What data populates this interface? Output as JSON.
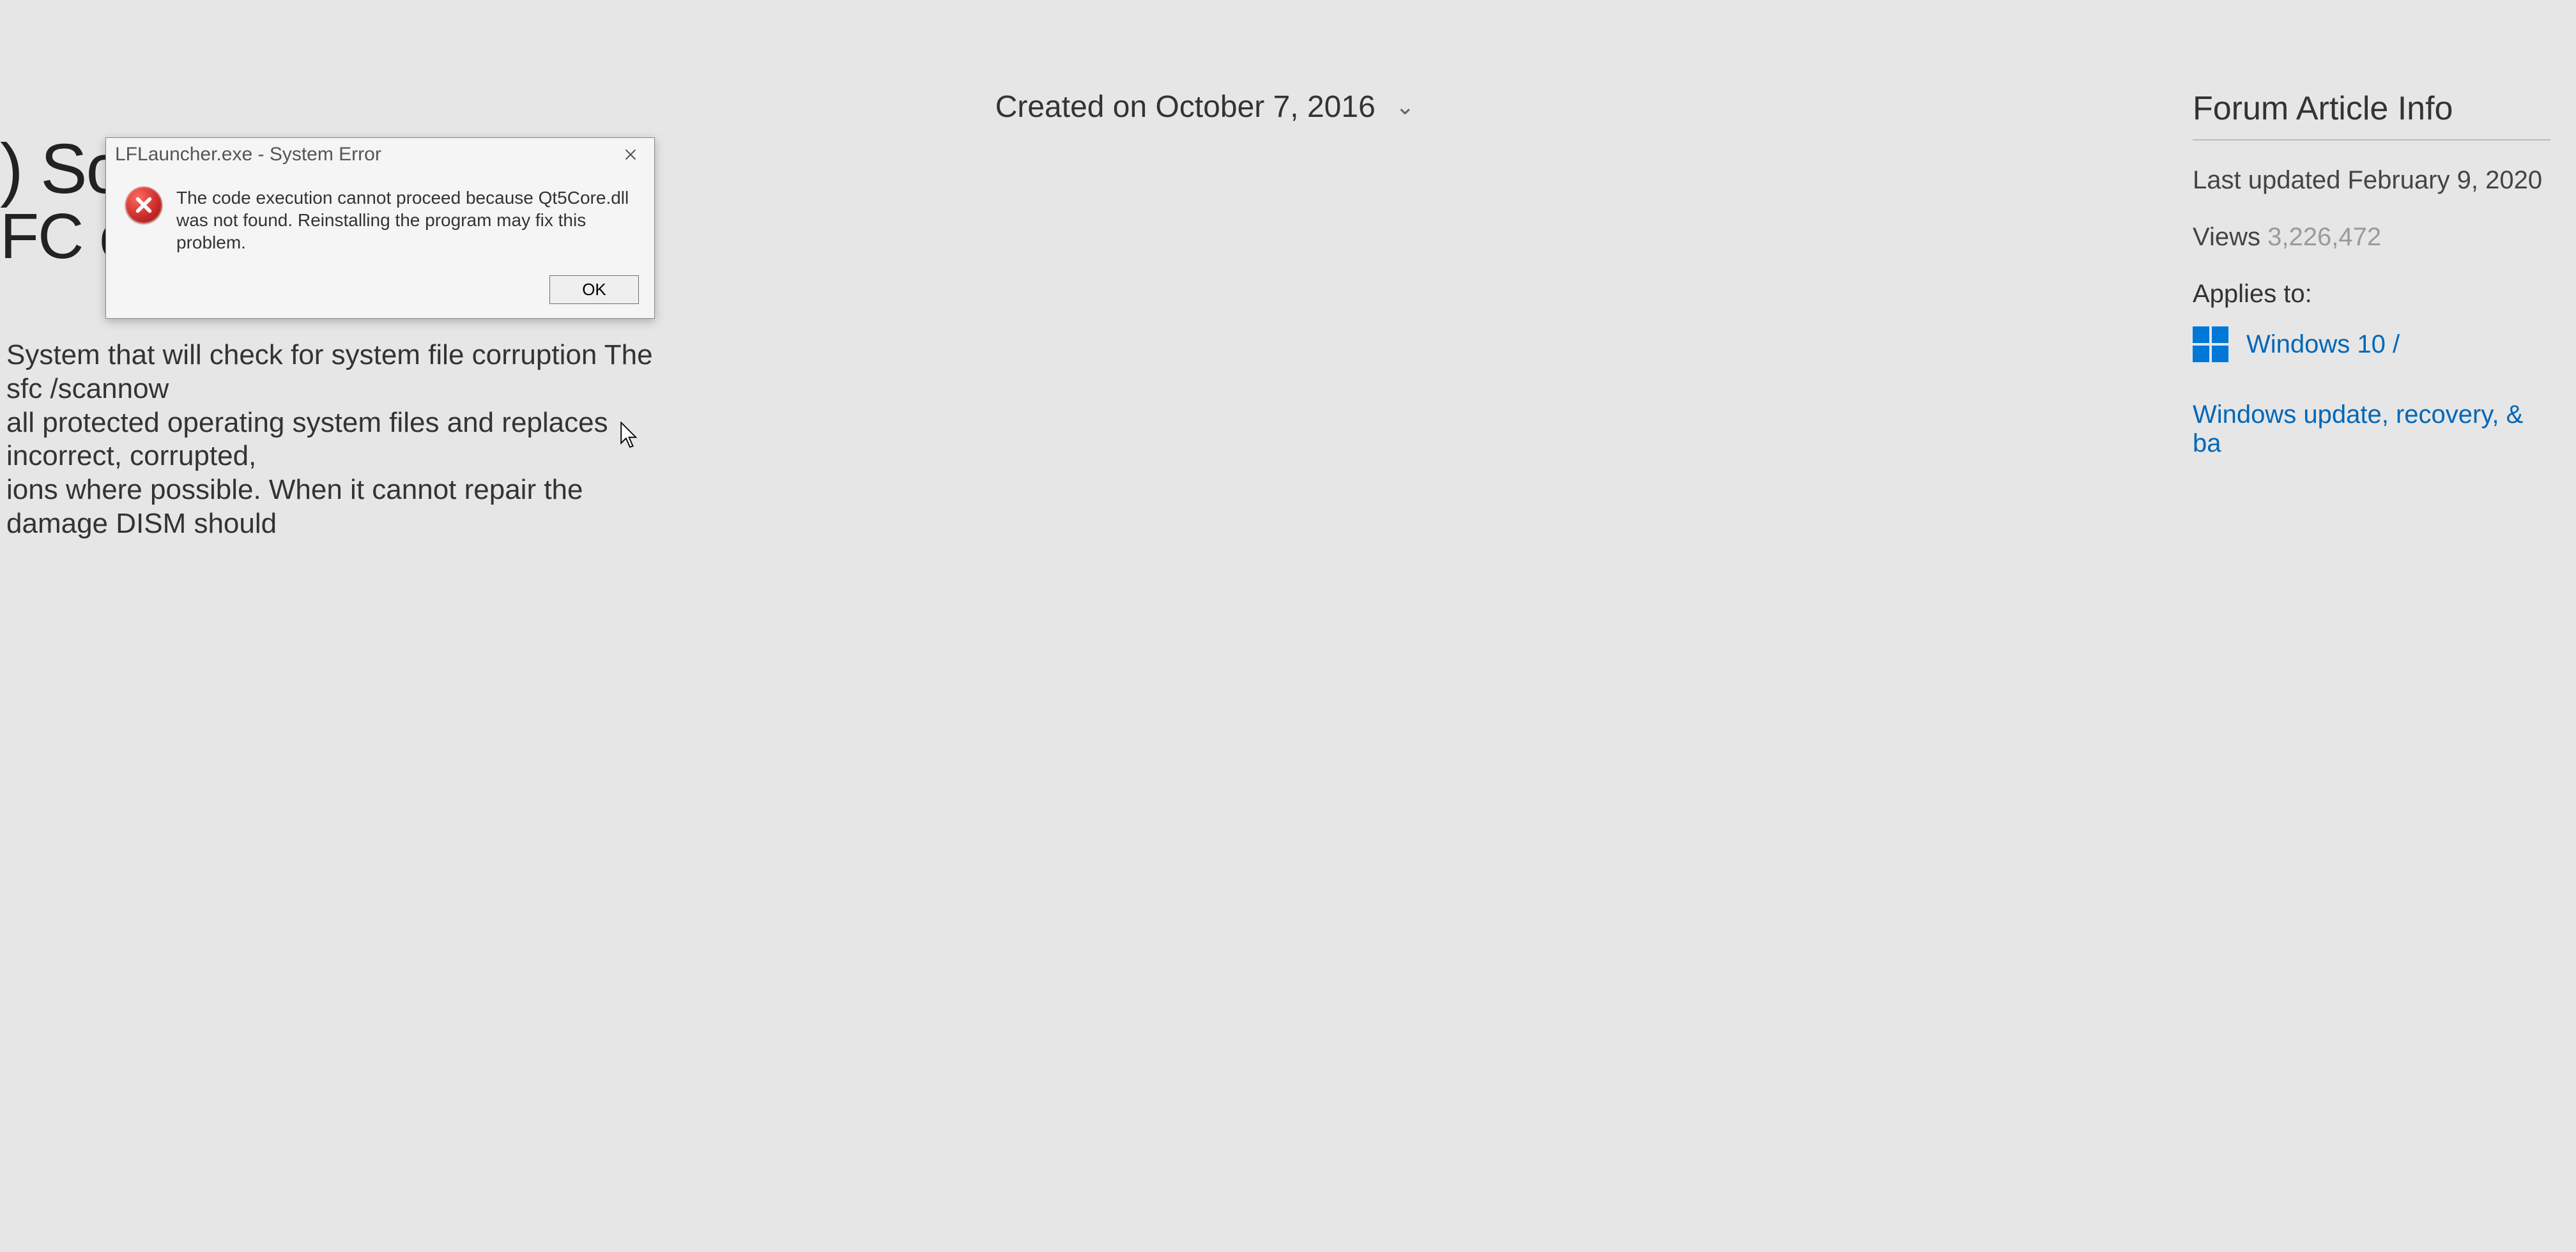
{
  "page": {
    "created_label": "Created on October 7, 2016",
    "title_line1": ") Sca",
    "title_line2": "FC ca",
    "body_line1": "System that will check for system file corruption The sfc /scannow",
    "body_line2": "all protected operating system files and replaces incorrect, corrupted,",
    "body_line3": "ions where possible.  When it cannot repair the damage DISM should"
  },
  "sidebar": {
    "heading": "Forum Article Info",
    "last_updated_label": "Last updated",
    "last_updated_value": "February 9, 2020",
    "views_label": "Views",
    "views_value": "3,226,472",
    "applies_label": "Applies to:",
    "windows_link": "Windows 10 /",
    "update_link": "Windows update, recovery, & ba"
  },
  "dialog": {
    "title": "LFLauncher.exe - System Error",
    "message": "The code execution cannot proceed because Qt5Core.dll was not found. Reinstalling the program may fix this problem.",
    "ok_label": "OK"
  }
}
